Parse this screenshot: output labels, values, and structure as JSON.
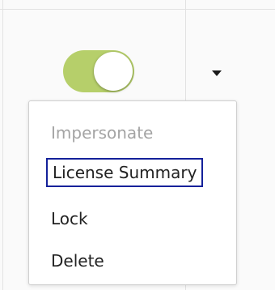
{
  "toggle": {
    "state": "on",
    "on_color": "#b6cf6a"
  },
  "dropdown": {
    "icon": "caret-down-icon"
  },
  "menu": {
    "items": [
      {
        "label": "Impersonate",
        "enabled": false
      },
      {
        "label": "License Summary",
        "enabled": true,
        "focused": true
      },
      {
        "label": "Lock",
        "enabled": true
      },
      {
        "label": "Delete",
        "enabled": true
      }
    ],
    "focus_color": "#14219a"
  }
}
